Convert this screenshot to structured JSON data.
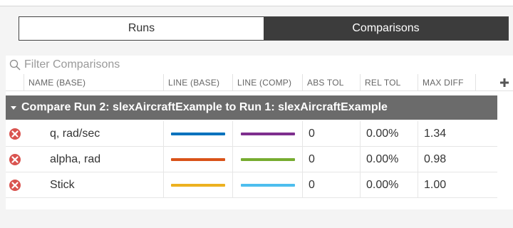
{
  "tabs": {
    "runs": "Runs",
    "comparisons": "Comparisons"
  },
  "filter": {
    "placeholder": "Filter Comparisons"
  },
  "columns": {
    "name": "NAME (BASE)",
    "line_base": "LINE (BASE)",
    "line_comp": "LINE (COMP)",
    "abs_tol": "ABS TOL",
    "rel_tol": "REL TOL",
    "max_diff": "MAX DIFF",
    "add_icon": "plus-icon"
  },
  "group": {
    "label": "Compare Run 2: slexAircraftExample to Run 1: slexAircraftExample"
  },
  "rows": [
    {
      "status_icon": "error-icon",
      "name": "q, rad/sec",
      "base_color": "#0072bd",
      "comp_color": "#7e2f8e",
      "abs_tol": "0",
      "rel_tol": "0.00%",
      "max_diff": "1.34"
    },
    {
      "status_icon": "error-icon",
      "name": "alpha, rad",
      "base_color": "#d95319",
      "comp_color": "#77ac30",
      "abs_tol": "0",
      "rel_tol": "0.00%",
      "max_diff": "0.98"
    },
    {
      "status_icon": "error-icon",
      "name": "Stick",
      "base_color": "#edb120",
      "comp_color": "#4dbeee",
      "abs_tol": "0",
      "rel_tol": "0.00%",
      "max_diff": "1.00"
    }
  ],
  "colors": {
    "active_tab": "#3c3c3c",
    "group_header": "#6b6b6b",
    "error": "#d9534f"
  }
}
